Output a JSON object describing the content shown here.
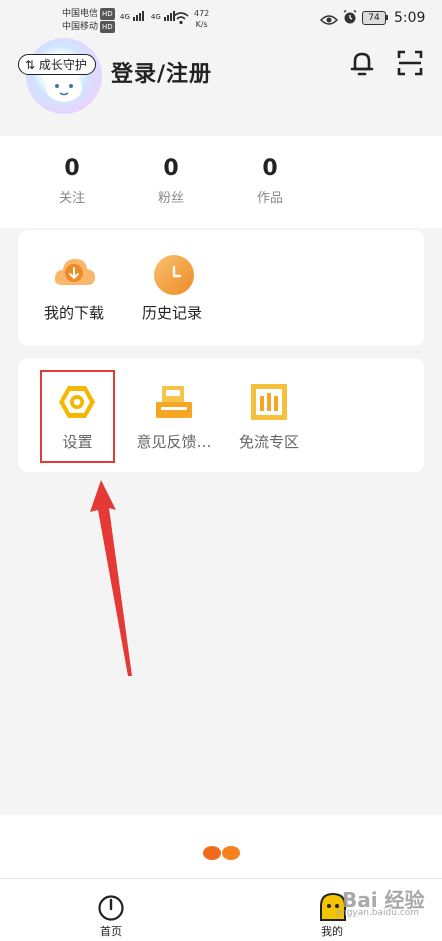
{
  "status_bar": {
    "carrier1": "中国电信",
    "carrier2": "中国移动",
    "hd": "HD",
    "net1": "4G",
    "net2": "4G",
    "speed_value": "472",
    "speed_unit": "K/s",
    "battery": "74",
    "time": "5:09"
  },
  "header": {
    "growth_guard": "成长守护",
    "login_title": "登录/注册"
  },
  "stats": [
    {
      "value": "0",
      "label": "关注"
    },
    {
      "value": "0",
      "label": "粉丝"
    },
    {
      "value": "0",
      "label": "作品"
    }
  ],
  "tools": [
    {
      "label": "我的下载",
      "icon": "download-icon"
    },
    {
      "label": "历史记录",
      "icon": "history-icon"
    }
  ],
  "services": [
    {
      "label": "设置",
      "icon": "settings-icon"
    },
    {
      "label": "意见反馈…",
      "icon": "feedback-icon"
    },
    {
      "label": "免流专区",
      "icon": "free-data-icon"
    }
  ],
  "bottom_nav": [
    {
      "label": "首页",
      "icon": "home-icon"
    },
    {
      "label": "我的",
      "icon": "profile-icon"
    }
  ],
  "watermark": "Bai 经验",
  "watermark_url": "jingyan.baidu.com",
  "colors": {
    "accent_orange": "#f5a623",
    "highlight_red": "#e53935",
    "settings_yellow": "#f5b800"
  }
}
